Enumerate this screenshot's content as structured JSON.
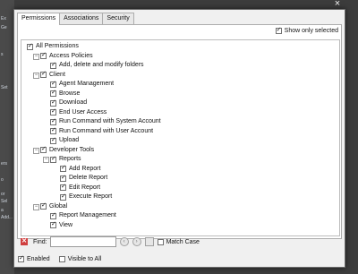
{
  "background_text": [
    "Ex",
    "Ge",
    "s",
    "Set",
    "ers",
    "o",
    "or",
    "Sel",
    "a",
    "Add..."
  ],
  "dialog": {
    "tabs": [
      "Permissions",
      "Associations",
      "Security"
    ],
    "show_only_selected": {
      "label": "Show only selected",
      "checked": true
    },
    "tree": [
      {
        "label": "All Permissions",
        "checked": true,
        "level": 0,
        "expanded": true
      },
      {
        "label": "Access Policies",
        "checked": true,
        "level": 1,
        "expanded": true
      },
      {
        "label": "Add, delete and modify folders",
        "checked": true,
        "level": 2
      },
      {
        "label": "Client",
        "checked": true,
        "level": 1,
        "expanded": true
      },
      {
        "label": "Agent Management",
        "checked": true,
        "level": 2
      },
      {
        "label": "Browse",
        "checked": true,
        "level": 2
      },
      {
        "label": "Download",
        "checked": true,
        "level": 2
      },
      {
        "label": "End User Access",
        "checked": true,
        "level": 2
      },
      {
        "label": "Run Command with System Account",
        "checked": true,
        "level": 2
      },
      {
        "label": "Run Command with User Account",
        "checked": true,
        "level": 2
      },
      {
        "label": "Upload",
        "checked": true,
        "level": 2
      },
      {
        "label": "Developer Tools",
        "checked": true,
        "level": 1,
        "expanded": true
      },
      {
        "label": "Reports",
        "checked": true,
        "level": 2,
        "expanded": true
      },
      {
        "label": "Add Report",
        "checked": true,
        "level": 3
      },
      {
        "label": "Delete Report",
        "checked": true,
        "level": 3
      },
      {
        "label": "Edit Report",
        "checked": true,
        "level": 3
      },
      {
        "label": "Execute Report",
        "checked": true,
        "level": 3
      },
      {
        "label": "Global",
        "checked": true,
        "level": 1,
        "expanded": true
      },
      {
        "label": "Report Management",
        "checked": true,
        "level": 2
      },
      {
        "label": "View",
        "checked": true,
        "level": 2
      }
    ],
    "find": {
      "label": "Find:",
      "value": "",
      "match_case_label": "Match Case",
      "match_case_checked": false
    },
    "enabled": {
      "label": "Enabled",
      "checked": true
    },
    "visible_to_all": {
      "label": "Visible to All",
      "checked": false
    }
  },
  "icons": {
    "close": "close-icon",
    "find_close": "find-close-icon",
    "find_prev": "find-previous-icon",
    "find_next": "find-next-icon",
    "highlight": "highlight-icon"
  }
}
